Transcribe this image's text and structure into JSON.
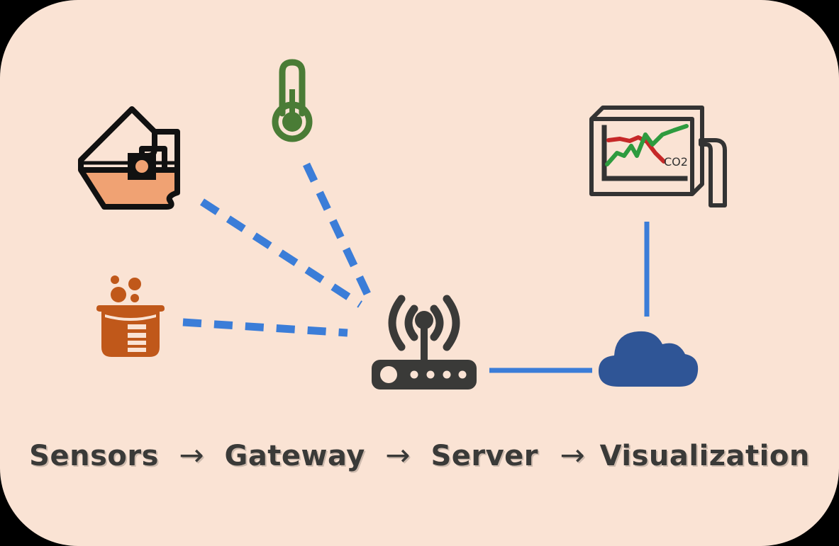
{
  "diagram": {
    "title": "IoT sensor to visualization pipeline",
    "background_color": "#FAE3D4",
    "outside_color": "#000000",
    "corner_radius_px": 110
  },
  "caption": {
    "steps": [
      "Sensors",
      "Gateway",
      "Server",
      "Visualization"
    ],
    "arrow": "→",
    "color": "#3A3A38"
  },
  "nodes": {
    "ship_sensor": {
      "label": "Ship sensor",
      "icon": "ship-sensor-icon",
      "outline_color": "#111111",
      "hull_color": "#F0A273",
      "port_color": "#F0A273"
    },
    "thermometer": {
      "label": "Thermometer",
      "icon": "thermometer-icon",
      "color": "#4A7C36"
    },
    "beaker": {
      "label": "Beaker",
      "icon": "beaker-icon",
      "color": "#C0581A",
      "bubble_count": 4,
      "graduation_count": 5
    },
    "gateway": {
      "label": "Gateway router",
      "icon": "router-icon",
      "color": "#3A3A38",
      "led_count": 5,
      "wave_arcs_per_side": 2
    },
    "server": {
      "label": "Cloud server",
      "icon": "cloud-icon",
      "color": "#2F5596"
    },
    "visualization": {
      "label": "Monitor dashboard",
      "icon": "monitor-chart-icon",
      "outline_color": "#333333",
      "chart_label": "CO2",
      "line_colors": {
        "rising": "#2E9B3F",
        "falling": "#C62828"
      }
    }
  },
  "connections": {
    "wireless_color": "#3B7DD8",
    "wired_color": "#3B7DD8",
    "links": [
      {
        "name": "ship-to-gateway",
        "style": "dashed"
      },
      {
        "name": "thermometer-to-gateway",
        "style": "dashed"
      },
      {
        "name": "beaker-to-gateway",
        "style": "dashed"
      },
      {
        "name": "gateway-to-server",
        "style": "solid"
      },
      {
        "name": "server-to-visualization",
        "style": "solid"
      }
    ]
  },
  "chart_data": {
    "type": "line",
    "title": "",
    "annotations": [
      "CO2"
    ],
    "xlabel": "",
    "ylabel": "",
    "grid": false,
    "legend": "none",
    "series": [
      {
        "name": "falling",
        "color": "#C62828",
        "x": [
          0,
          1,
          2,
          3,
          4,
          5,
          6
        ],
        "values": [
          78,
          76,
          74,
          72,
          62,
          50,
          44
        ]
      },
      {
        "name": "rising",
        "color": "#2E9B3F",
        "x": [
          0,
          1,
          2,
          3,
          4,
          5,
          6,
          7,
          8,
          9
        ],
        "values": [
          30,
          44,
          40,
          54,
          42,
          70,
          56,
          76,
          82,
          90
        ]
      }
    ],
    "ylim": [
      0,
      100
    ],
    "xlim": [
      0,
      9
    ]
  }
}
